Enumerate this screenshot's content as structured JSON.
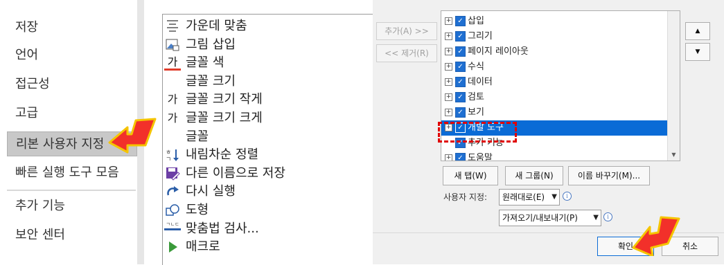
{
  "nav": {
    "items": [
      "저장",
      "언어",
      "접근성",
      "고급",
      "리본 사용자 지정",
      "빠른 실행 도구 모음",
      "추가 기능",
      "보안 센터"
    ],
    "selected_index": 4
  },
  "commands": [
    {
      "label": "가운데 맞춤",
      "icon": "center-align-icon"
    },
    {
      "label": "그림 삽입",
      "icon": "insert-picture-icon"
    },
    {
      "label": "글꼴 색",
      "icon": "font-color-icon",
      "glyph": "가"
    },
    {
      "label": "글꼴 크기",
      "icon": "font-size-icon"
    },
    {
      "label": "글꼴 크기 작게",
      "icon": "decrease-font-size-icon",
      "glyph": "가"
    },
    {
      "label": "글꼴 크기 크게",
      "icon": "increase-font-size-icon",
      "glyph": "가"
    },
    {
      "label": "글꼴",
      "icon": "font-icon"
    },
    {
      "label": "내림차순 정렬",
      "icon": "sort-descending-icon"
    },
    {
      "label": "다른 이름으로 저장",
      "icon": "save-as-icon"
    },
    {
      "label": "다시 실행",
      "icon": "redo-icon"
    },
    {
      "label": "도형",
      "icon": "shapes-icon"
    },
    {
      "label": "맞춤법 검사...",
      "icon": "spell-check-icon",
      "glyph": "ㄱㄴㄷ"
    },
    {
      "label": "매크로",
      "icon": "macro-play-icon"
    }
  ],
  "transfer": {
    "add_label": "추가(A) >>",
    "remove_label": "<< 제거(R)"
  },
  "tabs_tree": {
    "items": [
      {
        "label": "삽입",
        "checked": true,
        "selected": false
      },
      {
        "label": "그리기",
        "checked": true,
        "selected": false
      },
      {
        "label": "페이지 레이아웃",
        "checked": true,
        "selected": false
      },
      {
        "label": "수식",
        "checked": true,
        "selected": false
      },
      {
        "label": "데이터",
        "checked": true,
        "selected": false
      },
      {
        "label": "검토",
        "checked": true,
        "selected": false
      },
      {
        "label": "보기",
        "checked": true,
        "selected": false
      },
      {
        "label": "개발 도구",
        "checked": true,
        "selected": true
      },
      {
        "label": "추가 기능",
        "checked": true,
        "selected": false,
        "no_expander": true
      },
      {
        "label": "도움말",
        "checked": true,
        "selected": false
      }
    ]
  },
  "buttons": {
    "new_tab": "새 탭(W)",
    "new_group": "새 그룹(N)",
    "rename": "이름 바꾸기(M)...",
    "customize_label": "사용자 지정:",
    "reset": "원래대로(E)",
    "import_export": "가져오기/내보내기(P)",
    "ok": "확인",
    "cancel": "취소"
  },
  "colors": {
    "accent": "#0a6bd6",
    "selected_nav": "#c8c8c8",
    "highlight_red": "#e00000",
    "arrow_fill": "#f2302a",
    "arrow_outline": "#f5c400"
  }
}
